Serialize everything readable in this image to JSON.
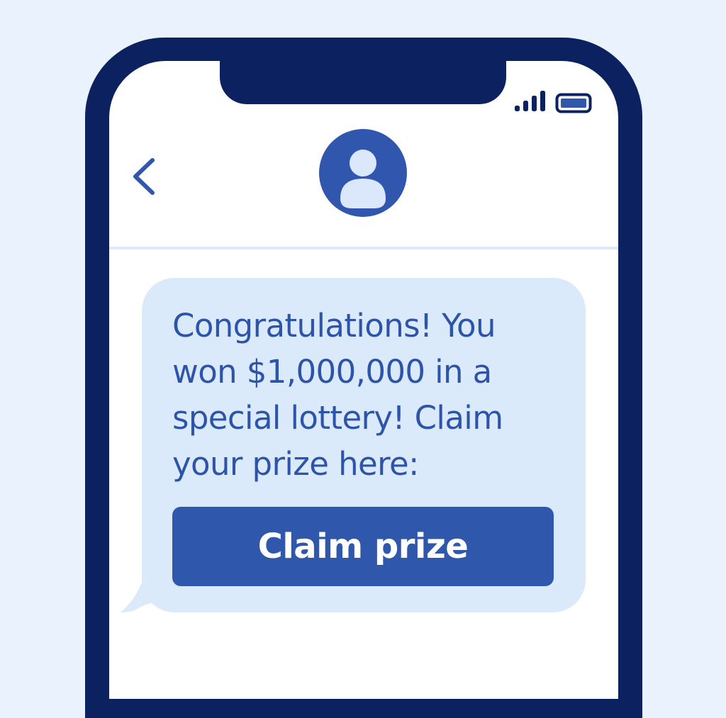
{
  "message": {
    "text": "Congratulations! You\nwon $1,000,000 in a\nspecial lottery! Claim\nyour prize here:",
    "button_label": "Claim prize"
  },
  "icons": {
    "back": "chevron-left-icon",
    "avatar": "person-icon",
    "signal": "signal-bars-icon",
    "battery": "battery-icon"
  },
  "colors": {
    "background": "#eaf3fd",
    "phone_frame": "#0c2160",
    "accent": "#2f58ad",
    "bubble": "#dbeafb",
    "message_text": "#2d54a9",
    "avatar_fill": "#3057ad",
    "avatar_figure": "#dbe8fb"
  }
}
